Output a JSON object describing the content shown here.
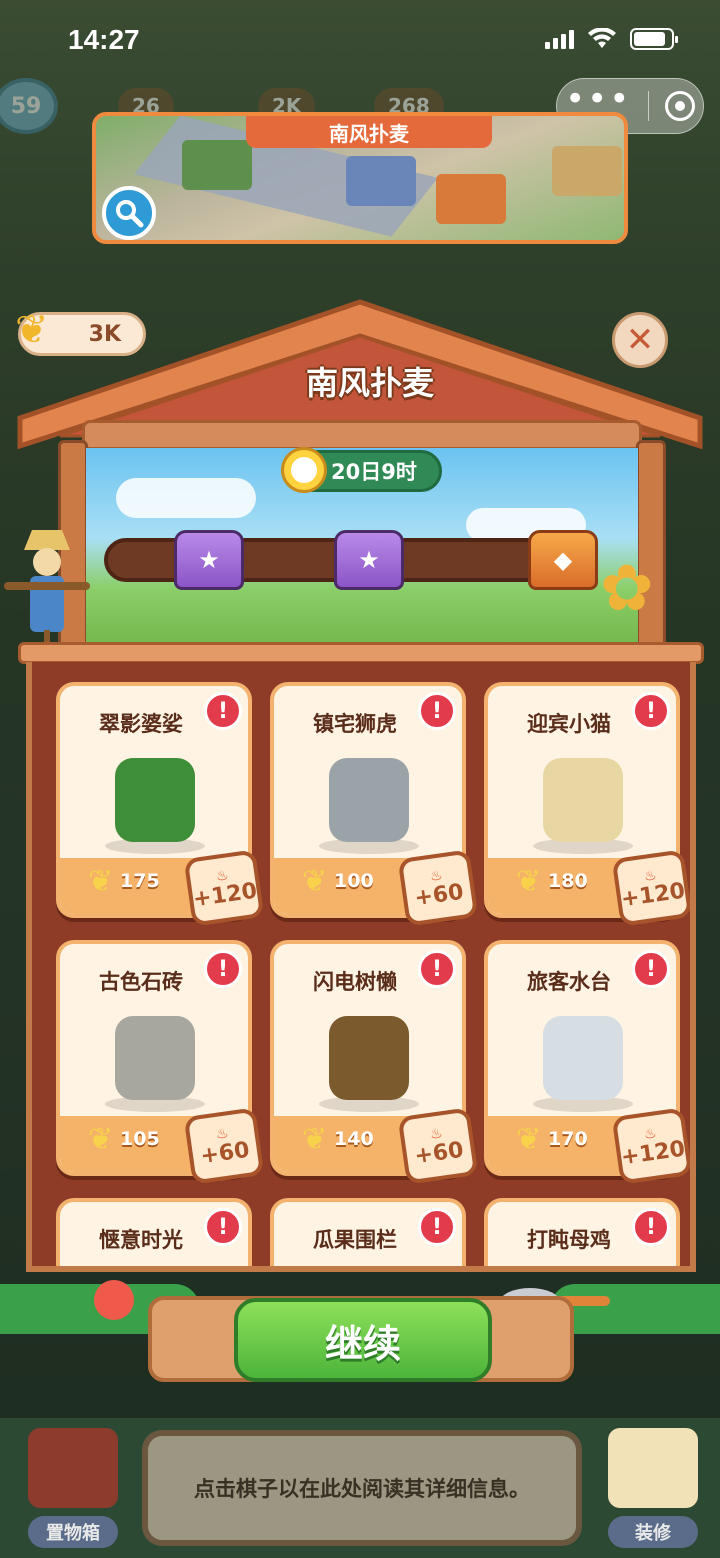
{
  "status_bar": {
    "time": "14:27",
    "battery_level": 0.85
  },
  "hud": {
    "level": "59",
    "pills": [
      "26",
      "2K",
      "268"
    ]
  },
  "preview": {
    "title": "南风扑麦",
    "search_icon": "magnifier-icon"
  },
  "panel": {
    "wheat_currency": "3K",
    "title": "南风扑麦",
    "timer": "20日9时",
    "progress": 0.0,
    "chests": [
      "purple",
      "purple",
      "gold"
    ],
    "continue_label": "继续"
  },
  "items": [
    {
      "name": "翠影婆娑",
      "cost": "175",
      "reward": "+120",
      "art": "tree-icon"
    },
    {
      "name": "镇宅狮虎",
      "cost": "100",
      "reward": "+60",
      "art": "stone-lion-icon"
    },
    {
      "name": "迎宾小猫",
      "cost": "180",
      "reward": "+120",
      "art": "cat-scooter-icon"
    },
    {
      "name": "古色石砖",
      "cost": "105",
      "reward": "+60",
      "art": "stone-tile-icon"
    },
    {
      "name": "闪电树懒",
      "cost": "140",
      "reward": "+60",
      "art": "sloth-stall-icon"
    },
    {
      "name": "旅客水台",
      "cost": "170",
      "reward": "+120",
      "art": "water-station-icon"
    },
    {
      "name": "惬意时光",
      "cost": "",
      "reward": "",
      "art": ""
    },
    {
      "name": "瓜果围栏",
      "cost": "",
      "reward": "",
      "art": ""
    },
    {
      "name": "打盹母鸡",
      "cost": "",
      "reward": "",
      "art": ""
    }
  ],
  "bottom": {
    "info_text": "点击棋子以在此处阅读其详细信息。",
    "storage_label": "置物箱",
    "decorate_label": "装修"
  },
  "colors": {
    "accent": "#f08a3e",
    "button_green": "#4cb43a",
    "alert_red": "#e23b4b"
  }
}
